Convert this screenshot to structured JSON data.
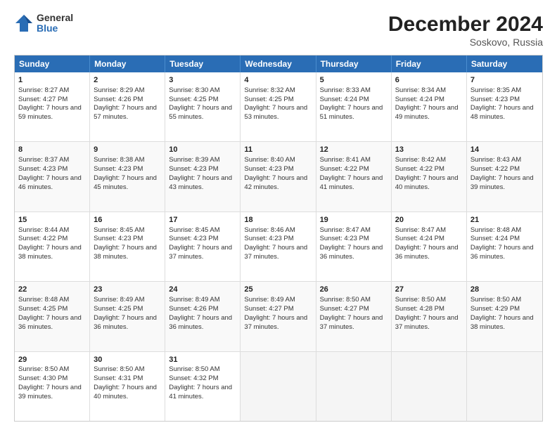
{
  "logo": {
    "general": "General",
    "blue": "Blue"
  },
  "title": {
    "month": "December 2024",
    "location": "Soskovo, Russia"
  },
  "calendar": {
    "headers": [
      "Sunday",
      "Monday",
      "Tuesday",
      "Wednesday",
      "Thursday",
      "Friday",
      "Saturday"
    ],
    "rows": [
      [
        {
          "day": "1",
          "sunrise": "8:27 AM",
          "sunset": "4:27 PM",
          "daylight": "7 hours and 59 minutes."
        },
        {
          "day": "2",
          "sunrise": "8:29 AM",
          "sunset": "4:26 PM",
          "daylight": "7 hours and 57 minutes."
        },
        {
          "day": "3",
          "sunrise": "8:30 AM",
          "sunset": "4:25 PM",
          "daylight": "7 hours and 55 minutes."
        },
        {
          "day": "4",
          "sunrise": "8:32 AM",
          "sunset": "4:25 PM",
          "daylight": "7 hours and 53 minutes."
        },
        {
          "day": "5",
          "sunrise": "8:33 AM",
          "sunset": "4:24 PM",
          "daylight": "7 hours and 51 minutes."
        },
        {
          "day": "6",
          "sunrise": "8:34 AM",
          "sunset": "4:24 PM",
          "daylight": "7 hours and 49 minutes."
        },
        {
          "day": "7",
          "sunrise": "8:35 AM",
          "sunset": "4:23 PM",
          "daylight": "7 hours and 48 minutes."
        }
      ],
      [
        {
          "day": "8",
          "sunrise": "8:37 AM",
          "sunset": "4:23 PM",
          "daylight": "7 hours and 46 minutes."
        },
        {
          "day": "9",
          "sunrise": "8:38 AM",
          "sunset": "4:23 PM",
          "daylight": "7 hours and 45 minutes."
        },
        {
          "day": "10",
          "sunrise": "8:39 AM",
          "sunset": "4:23 PM",
          "daylight": "7 hours and 43 minutes."
        },
        {
          "day": "11",
          "sunrise": "8:40 AM",
          "sunset": "4:23 PM",
          "daylight": "7 hours and 42 minutes."
        },
        {
          "day": "12",
          "sunrise": "8:41 AM",
          "sunset": "4:22 PM",
          "daylight": "7 hours and 41 minutes."
        },
        {
          "day": "13",
          "sunrise": "8:42 AM",
          "sunset": "4:22 PM",
          "daylight": "7 hours and 40 minutes."
        },
        {
          "day": "14",
          "sunrise": "8:43 AM",
          "sunset": "4:22 PM",
          "daylight": "7 hours and 39 minutes."
        }
      ],
      [
        {
          "day": "15",
          "sunrise": "8:44 AM",
          "sunset": "4:22 PM",
          "daylight": "7 hours and 38 minutes."
        },
        {
          "day": "16",
          "sunrise": "8:45 AM",
          "sunset": "4:23 PM",
          "daylight": "7 hours and 38 minutes."
        },
        {
          "day": "17",
          "sunrise": "8:45 AM",
          "sunset": "4:23 PM",
          "daylight": "7 hours and 37 minutes."
        },
        {
          "day": "18",
          "sunrise": "8:46 AM",
          "sunset": "4:23 PM",
          "daylight": "7 hours and 37 minutes."
        },
        {
          "day": "19",
          "sunrise": "8:47 AM",
          "sunset": "4:23 PM",
          "daylight": "7 hours and 36 minutes."
        },
        {
          "day": "20",
          "sunrise": "8:47 AM",
          "sunset": "4:24 PM",
          "daylight": "7 hours and 36 minutes."
        },
        {
          "day": "21",
          "sunrise": "8:48 AM",
          "sunset": "4:24 PM",
          "daylight": "7 hours and 36 minutes."
        }
      ],
      [
        {
          "day": "22",
          "sunrise": "8:48 AM",
          "sunset": "4:25 PM",
          "daylight": "7 hours and 36 minutes."
        },
        {
          "day": "23",
          "sunrise": "8:49 AM",
          "sunset": "4:25 PM",
          "daylight": "7 hours and 36 minutes."
        },
        {
          "day": "24",
          "sunrise": "8:49 AM",
          "sunset": "4:26 PM",
          "daylight": "7 hours and 36 minutes."
        },
        {
          "day": "25",
          "sunrise": "8:49 AM",
          "sunset": "4:27 PM",
          "daylight": "7 hours and 37 minutes."
        },
        {
          "day": "26",
          "sunrise": "8:50 AM",
          "sunset": "4:27 PM",
          "daylight": "7 hours and 37 minutes."
        },
        {
          "day": "27",
          "sunrise": "8:50 AM",
          "sunset": "4:28 PM",
          "daylight": "7 hours and 37 minutes."
        },
        {
          "day": "28",
          "sunrise": "8:50 AM",
          "sunset": "4:29 PM",
          "daylight": "7 hours and 38 minutes."
        }
      ],
      [
        {
          "day": "29",
          "sunrise": "8:50 AM",
          "sunset": "4:30 PM",
          "daylight": "7 hours and 39 minutes."
        },
        {
          "day": "30",
          "sunrise": "8:50 AM",
          "sunset": "4:31 PM",
          "daylight": "7 hours and 40 minutes."
        },
        {
          "day": "31",
          "sunrise": "8:50 AM",
          "sunset": "4:32 PM",
          "daylight": "7 hours and 41 minutes."
        },
        null,
        null,
        null,
        null
      ]
    ]
  }
}
